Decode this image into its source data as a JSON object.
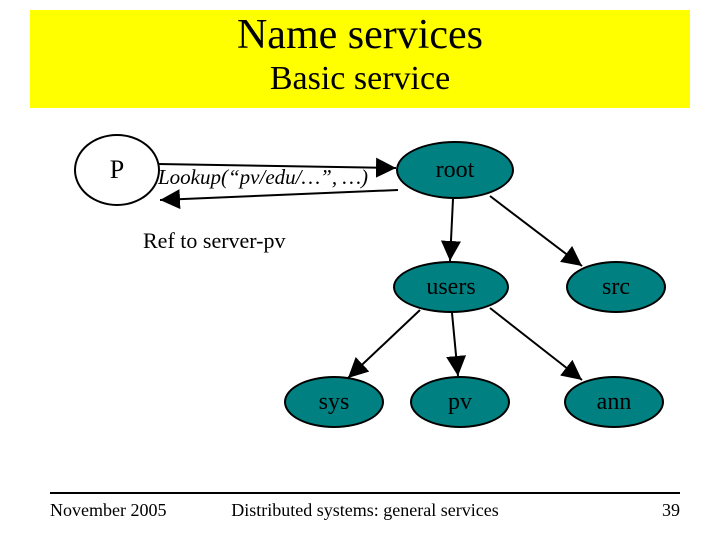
{
  "title": {
    "main": "Name services",
    "sub": "Basic service"
  },
  "nodes": {
    "p": "P",
    "root": "root",
    "users": "users",
    "src": "src",
    "sys": "sys",
    "pv": "pv",
    "ann": "ann"
  },
  "labels": {
    "lookup": "Lookup(“pv/edu/…”, …)",
    "ref": "Ref to server-pv"
  },
  "footer": {
    "left": "November 2005",
    "center": "Distributed systems: general services",
    "right": "39"
  },
  "colors": {
    "band": "#ffff00",
    "node_fill": "#008080"
  }
}
